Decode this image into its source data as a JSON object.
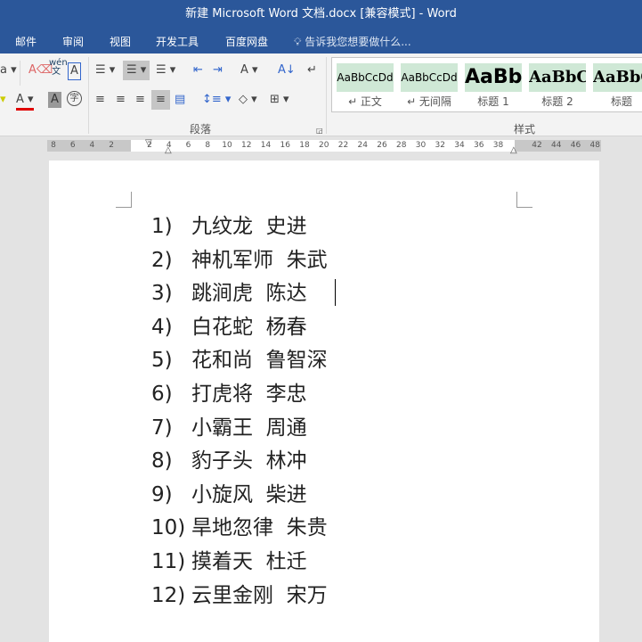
{
  "window": {
    "title": "新建 Microsoft Word 文档.docx [兼容模式] - Word"
  },
  "tabs": [
    "邮件",
    "审阅",
    "视图",
    "开发工具",
    "百度网盘"
  ],
  "tell_me": "告诉我您想要做什么...",
  "ribbon": {
    "paragraph_group": "段落",
    "styles_group": "样式",
    "styles": [
      {
        "preview": "AaBbCcDd",
        "name": "↵ 正文"
      },
      {
        "preview": "AaBbCcDd",
        "name": "↵ 无间隔"
      },
      {
        "preview": "AaBb",
        "name": "标题 1"
      },
      {
        "preview": "AaBbC",
        "name": "标题 2"
      },
      {
        "preview": "AaBbC",
        "name": "标题"
      }
    ],
    "font_color": "#e00000",
    "highlight_color": "#ffff00"
  },
  "ruler": {
    "left": [
      "8",
      "6",
      "4",
      "2"
    ],
    "right": [
      "2",
      "4",
      "6",
      "8",
      "10",
      "12",
      "14",
      "16",
      "18",
      "20",
      "22",
      "24",
      "26",
      "28",
      "30",
      "32",
      "34",
      "36",
      "38",
      "",
      "42",
      "44",
      "46",
      "48"
    ]
  },
  "document": {
    "items": [
      {
        "num": "1)",
        "text": "九纹龙  史进"
      },
      {
        "num": "2)",
        "text": "神机军师  朱武"
      },
      {
        "num": "3)",
        "text": "跳涧虎  陈达"
      },
      {
        "num": "4)",
        "text": "白花蛇  杨春"
      },
      {
        "num": "5)",
        "text": "花和尚  鲁智深"
      },
      {
        "num": "6)",
        "text": "打虎将  李忠"
      },
      {
        "num": "7)",
        "text": "小霸王  周通"
      },
      {
        "num": "8)",
        "text": "豹子头  林冲"
      },
      {
        "num": "9)",
        "text": "小旋风  柴进"
      },
      {
        "num": "10)",
        "text": "旱地忽律  朱贵"
      },
      {
        "num": "11)",
        "text": "摸着天  杜迁"
      },
      {
        "num": "12)",
        "text": "云里金刚  宋万"
      }
    ]
  }
}
